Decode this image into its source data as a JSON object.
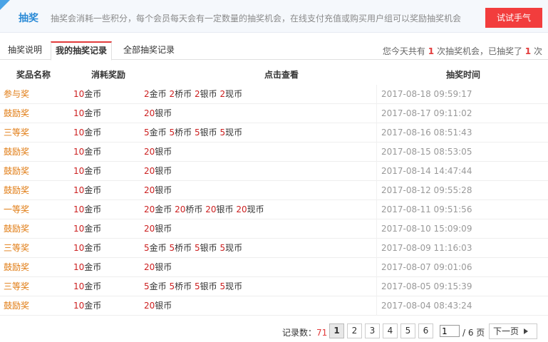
{
  "banner": {
    "title": "抽奖",
    "description": "抽奖会消耗一些积分，每个会员每天会有一定数量的抽奖机会，在线支付充值或购买用户组可以奖励抽奖机会",
    "try_button": "试试手气"
  },
  "tabs": [
    {
      "label": "抽奖说明",
      "active": false
    },
    {
      "label": "我的抽奖记录",
      "active": true
    },
    {
      "label": "全部抽奖记录",
      "active": false
    }
  ],
  "chance": {
    "prefix": "您今天共有",
    "total": "1",
    "middle": "次抽奖机会，已抽奖了",
    "used": "1",
    "suffix": "次"
  },
  "columns": [
    "奖品名称",
    "消耗奖励",
    "点击查看",
    "抽奖时间"
  ],
  "rows": [
    {
      "prize": "参与奖",
      "cost_num": "10",
      "cost_unit": "金币",
      "reward": [
        [
          "2",
          "金币"
        ],
        [
          "2",
          "桥币"
        ],
        [
          "2",
          "银币"
        ],
        [
          "2",
          "现币"
        ]
      ],
      "time": "2017-08-18 09:59:17"
    },
    {
      "prize": "鼓励奖",
      "cost_num": "10",
      "cost_unit": "金币",
      "reward": [
        [
          "20",
          "银币"
        ]
      ],
      "time": "2017-08-17 09:11:02"
    },
    {
      "prize": "三等奖",
      "cost_num": "10",
      "cost_unit": "金币",
      "reward": [
        [
          "5",
          "金币"
        ],
        [
          "5",
          "桥币"
        ],
        [
          "5",
          "银币"
        ],
        [
          "5",
          "现币"
        ]
      ],
      "time": "2017-08-16 08:51:43"
    },
    {
      "prize": "鼓励奖",
      "cost_num": "10",
      "cost_unit": "金币",
      "reward": [
        [
          "20",
          "银币"
        ]
      ],
      "time": "2017-08-15 08:53:05"
    },
    {
      "prize": "鼓励奖",
      "cost_num": "10",
      "cost_unit": "金币",
      "reward": [
        [
          "20",
          "银币"
        ]
      ],
      "time": "2017-08-14 14:47:44"
    },
    {
      "prize": "鼓励奖",
      "cost_num": "10",
      "cost_unit": "金币",
      "reward": [
        [
          "20",
          "银币"
        ]
      ],
      "time": "2017-08-12 09:55:28"
    },
    {
      "prize": "一等奖",
      "cost_num": "10",
      "cost_unit": "金币",
      "reward": [
        [
          "20",
          "金币"
        ],
        [
          "20",
          "桥币"
        ],
        [
          "20",
          "银币"
        ],
        [
          "20",
          "现币"
        ]
      ],
      "time": "2017-08-11 09:51:56"
    },
    {
      "prize": "鼓励奖",
      "cost_num": "10",
      "cost_unit": "金币",
      "reward": [
        [
          "20",
          "银币"
        ]
      ],
      "time": "2017-08-10 15:09:09"
    },
    {
      "prize": "三等奖",
      "cost_num": "10",
      "cost_unit": "金币",
      "reward": [
        [
          "5",
          "金币"
        ],
        [
          "5",
          "桥币"
        ],
        [
          "5",
          "银币"
        ],
        [
          "5",
          "现币"
        ]
      ],
      "time": "2017-08-09 11:16:03"
    },
    {
      "prize": "鼓励奖",
      "cost_num": "10",
      "cost_unit": "金币",
      "reward": [
        [
          "20",
          "银币"
        ]
      ],
      "time": "2017-08-07 09:01:06"
    },
    {
      "prize": "三等奖",
      "cost_num": "10",
      "cost_unit": "金币",
      "reward": [
        [
          "5",
          "金币"
        ],
        [
          "5",
          "桥币"
        ],
        [
          "5",
          "银币"
        ],
        [
          "5",
          "现币"
        ]
      ],
      "time": "2017-08-05 09:15:39"
    },
    {
      "prize": "鼓励奖",
      "cost_num": "10",
      "cost_unit": "金币",
      "reward": [
        [
          "20",
          "银币"
        ]
      ],
      "time": "2017-08-04 08:43:24"
    }
  ],
  "pager": {
    "record_label": "记录数：",
    "record_count": "71",
    "pages": [
      "1",
      "2",
      "3",
      "4",
      "5",
      "6"
    ],
    "current_page": "1",
    "page_input_value": "1",
    "page_total": "/ 6 页",
    "next_label": "下一页"
  },
  "colors": {
    "accent_red": "#f23d3d",
    "prize_orange": "#e07a10",
    "banner_blue": "#2a8ad6"
  }
}
